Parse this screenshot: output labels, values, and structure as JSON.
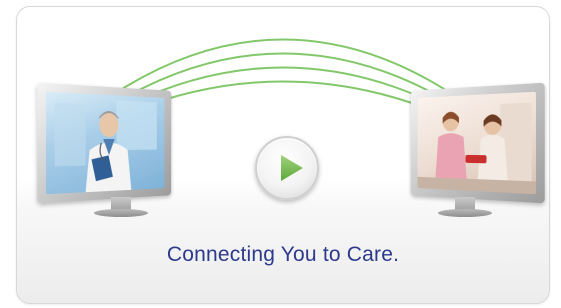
{
  "hero": {
    "caption": "Connecting You to Care.",
    "colors": {
      "arc": "#7cc464",
      "caption": "#2c3a8c",
      "play": "#74b94e"
    }
  },
  "play_button": {
    "icon": "play-icon"
  }
}
